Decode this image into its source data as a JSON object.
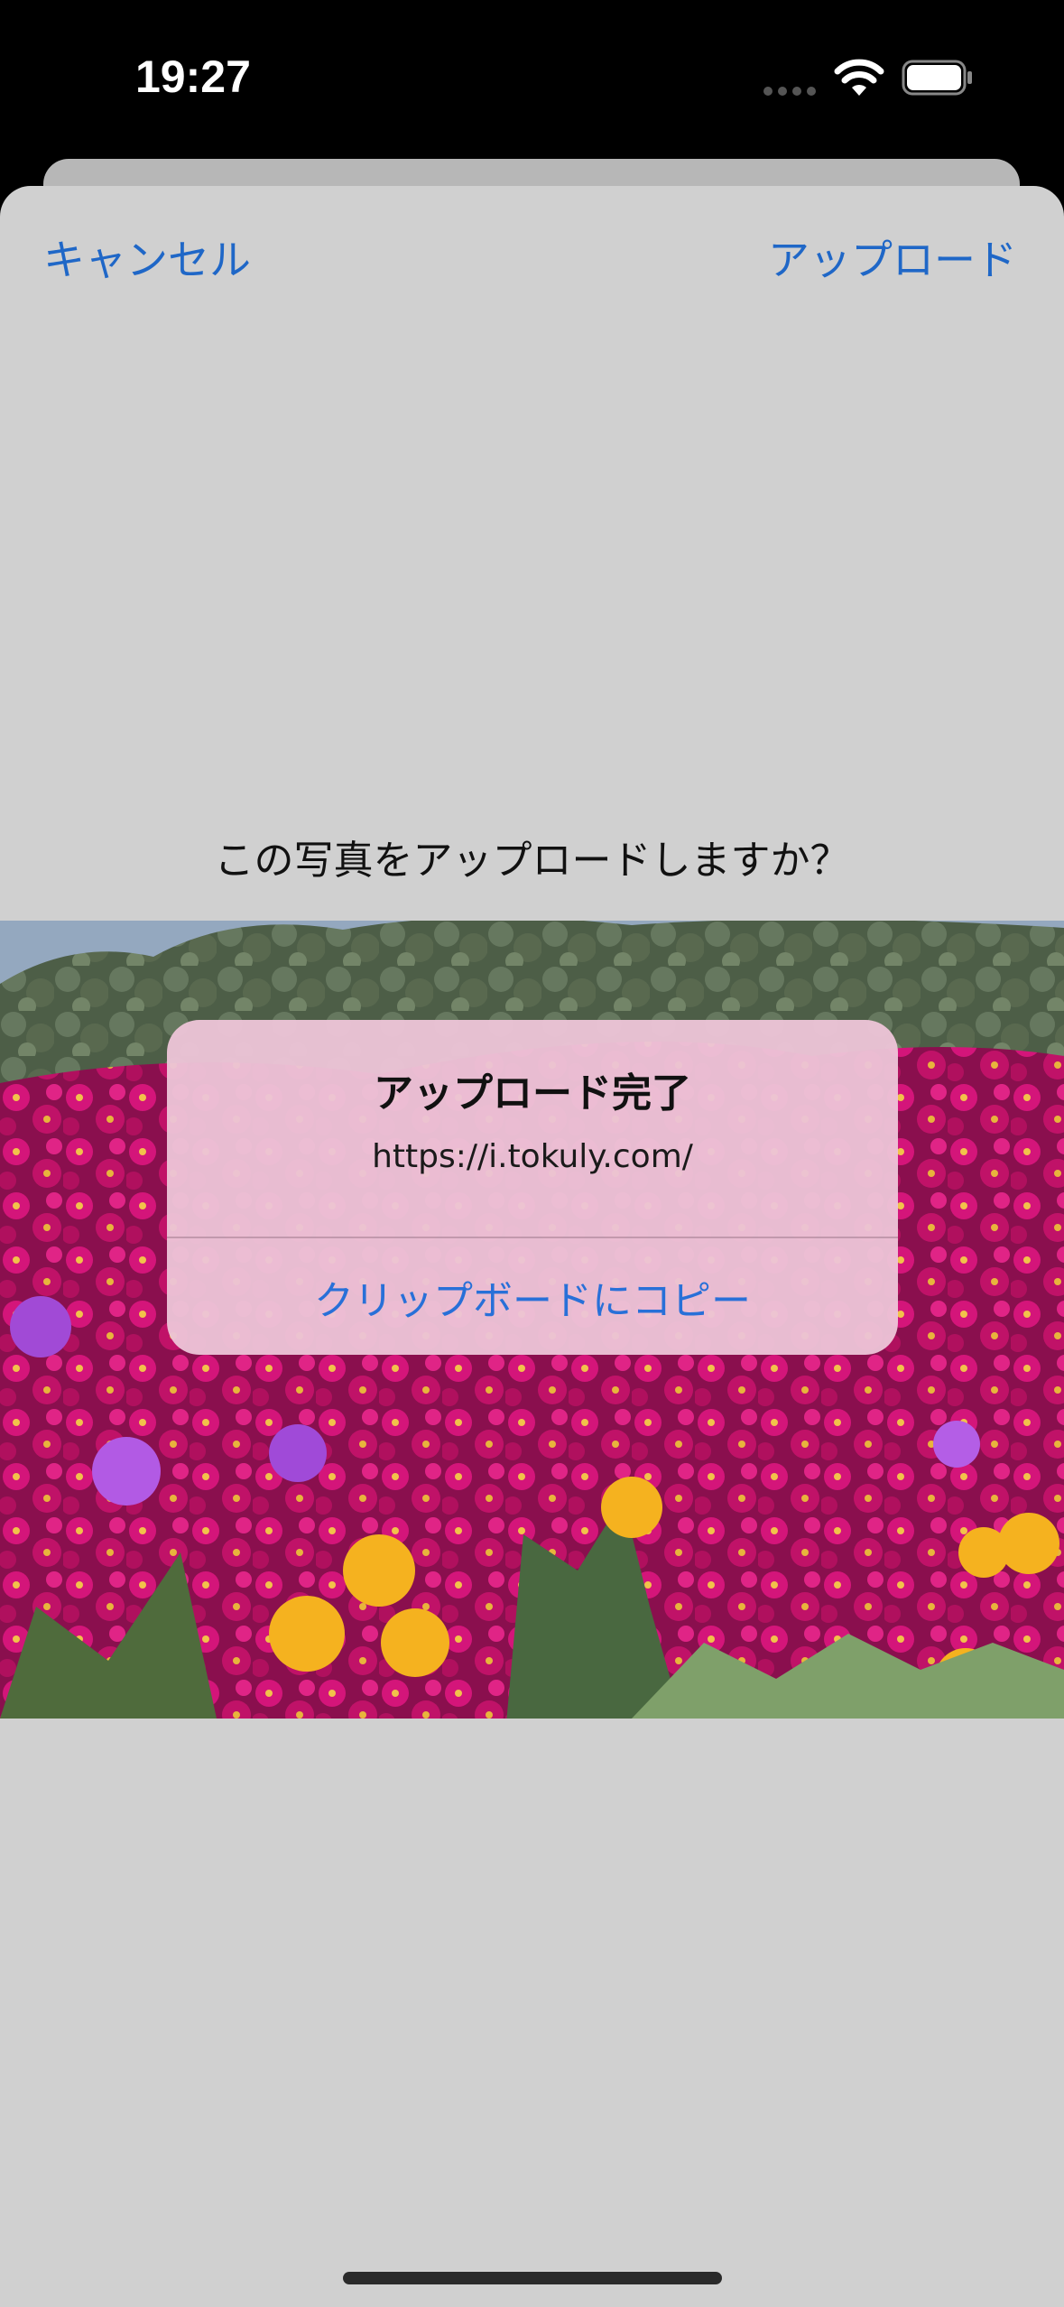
{
  "status_bar": {
    "time": "19:27",
    "icons": [
      "signal-dots-icon",
      "wifi-icon",
      "battery-icon"
    ]
  },
  "nav": {
    "cancel_label": "キャンセル",
    "upload_label": "アップロード",
    "accent_color": "#1f67c7"
  },
  "main": {
    "prompt": "この写真をアップロードしますか？"
  },
  "alert": {
    "title": "アップロード完了",
    "message": "https://i.tokuly.com/",
    "action_label": "クリップボードにコピー"
  }
}
